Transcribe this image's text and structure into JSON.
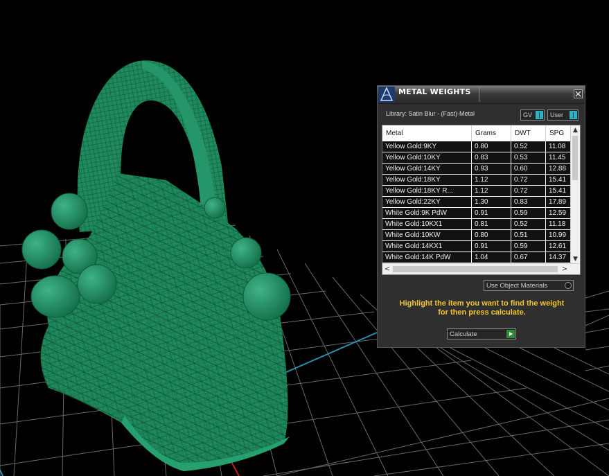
{
  "panel": {
    "title": "METAL WEIGHTS",
    "close_glyph": "X",
    "library_label": "Library: Satin Blur - (Fast)-Metal",
    "gv_toggle": "GV",
    "user_toggle": "User",
    "columns": [
      "Metal",
      "Grams",
      "DWT",
      "SPG"
    ],
    "rows": [
      [
        "Yellow Gold:9KY",
        "0.80",
        "0.52",
        "11.08"
      ],
      [
        "Yellow Gold:10KY",
        "0.83",
        "0.53",
        "11.45"
      ],
      [
        "Yellow Gold:14KY",
        "0.93",
        "0.60",
        "12.88"
      ],
      [
        "Yellow Gold:18KY",
        "1.12",
        "0.72",
        "15.41"
      ],
      [
        "Yellow Gold:18KY R...",
        "1.12",
        "0.72",
        "15.41"
      ],
      [
        "Yellow Gold:22KY",
        "1.30",
        "0.83",
        "17.89"
      ],
      [
        "White Gold:9K PdW",
        "0.91",
        "0.59",
        "12.59"
      ],
      [
        "White Gold:10KX1",
        "0.81",
        "0.52",
        "11.18"
      ],
      [
        "White Gold:10KW",
        "0.80",
        "0.51",
        "10.99"
      ],
      [
        "White Gold:14KX1",
        "0.91",
        "0.59",
        "12.61"
      ],
      [
        "White Gold:14K PdW",
        "1.04",
        "0.67",
        "14.37"
      ]
    ],
    "use_object_materials": "Use Object Materials",
    "instructions_line1": "Highlight the item you want to find the weight",
    "instructions_line2": "for then press calculate.",
    "calculate_label": "Calculate"
  },
  "colors": {
    "model": "#1f8a5c",
    "accent_toggle": "#2fb2c1",
    "instruction_text": "#f2c531",
    "grid_axis_x": "#c02020",
    "grid_axis_y": "#2a8fa8"
  }
}
